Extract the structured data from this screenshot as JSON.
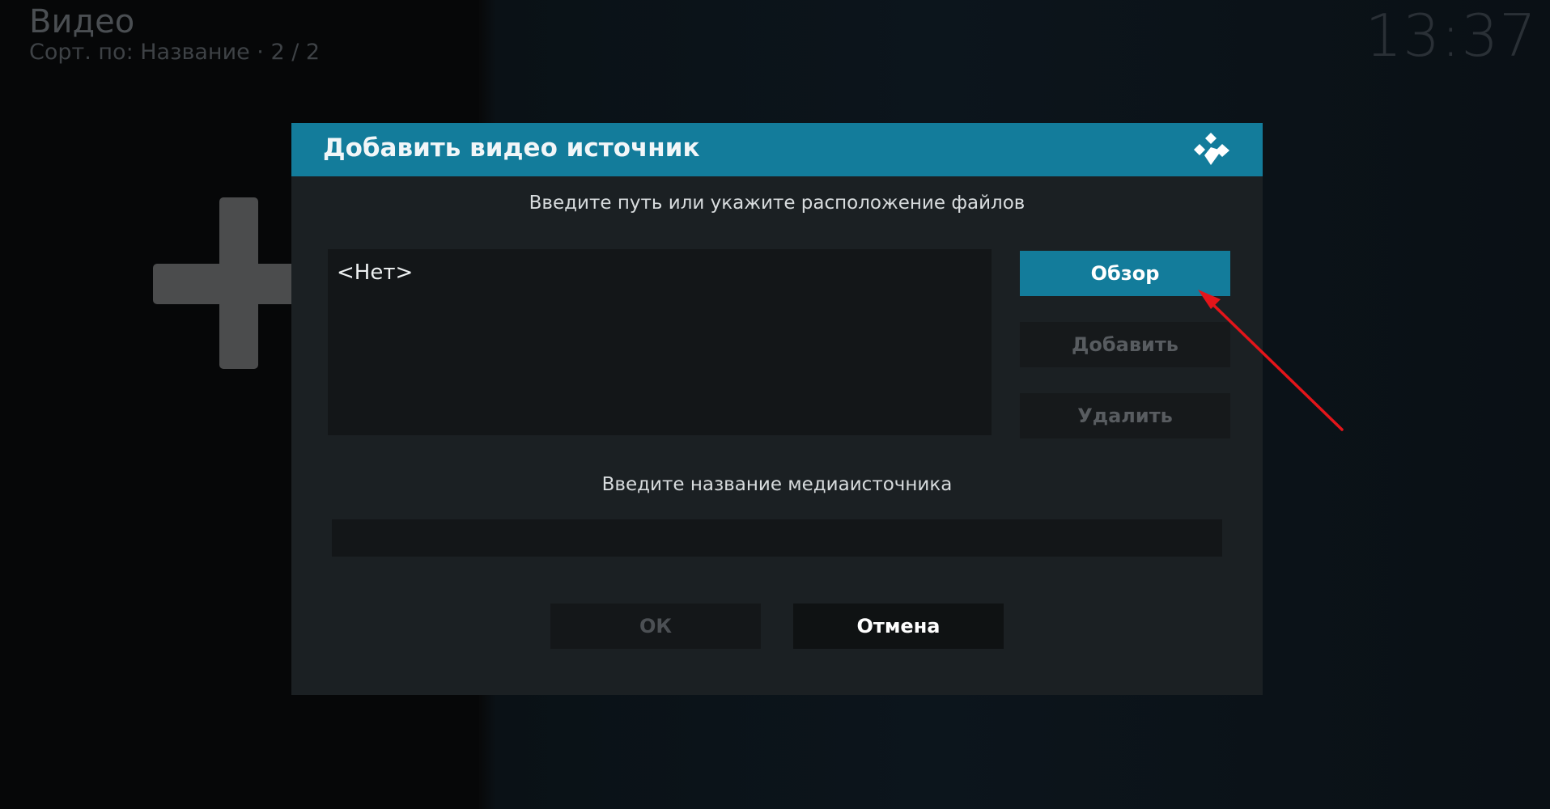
{
  "header": {
    "title": "Видео",
    "subtitle": "Сорт. по: Название  ·  2 / 2"
  },
  "clock": "13:37",
  "dialog": {
    "title": "Добавить видео источник",
    "path_prompt": "Введите путь или укажите расположение файлов",
    "path_items": [
      "<Нет>"
    ],
    "browse_label": "Обзор",
    "add_label": "Добавить",
    "remove_label": "Удалить",
    "name_prompt": "Введите название медиаисточника",
    "name_value": "",
    "ok_label": "ОК",
    "cancel_label": "Отмена"
  },
  "colors": {
    "accent": "#137c9b",
    "annotation_arrow": "#e3151a"
  },
  "icons": {
    "logo": "kodi-logo-icon",
    "add_tile": "plus-icon"
  }
}
